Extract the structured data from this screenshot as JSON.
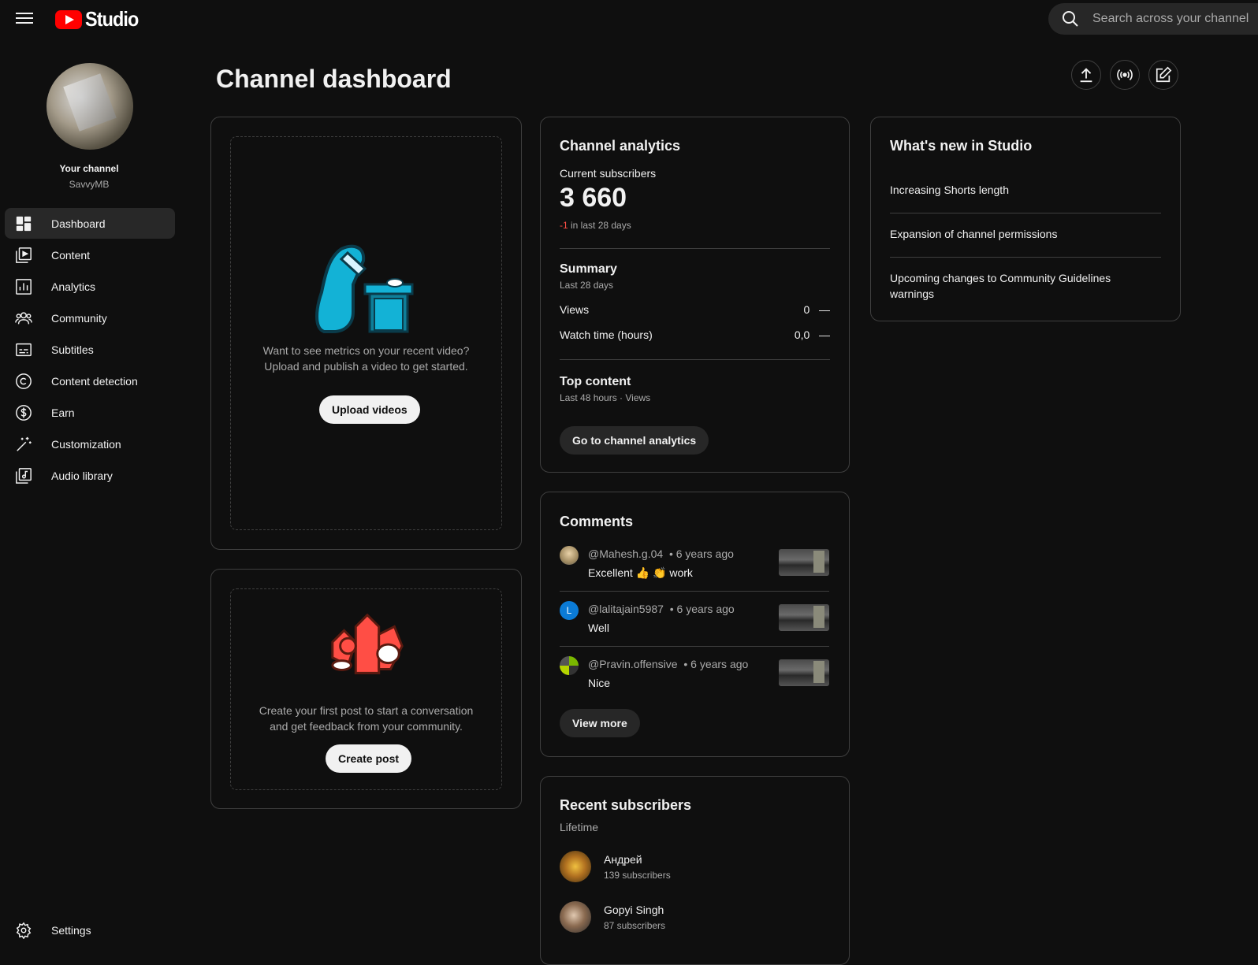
{
  "app": {
    "title": "Studio"
  },
  "search": {
    "placeholder": "Search across your channel"
  },
  "channel": {
    "label": "Your channel",
    "name": "SavvyMB"
  },
  "nav": [
    {
      "label": "Dashboard",
      "icon": "dashboard-icon",
      "active": true
    },
    {
      "label": "Content",
      "icon": "content-icon"
    },
    {
      "label": "Analytics",
      "icon": "analytics-icon"
    },
    {
      "label": "Community",
      "icon": "community-icon"
    },
    {
      "label": "Subtitles",
      "icon": "subtitles-icon"
    },
    {
      "label": "Content detection",
      "icon": "copyright-icon"
    },
    {
      "label": "Earn",
      "icon": "dollar-icon"
    },
    {
      "label": "Customization",
      "icon": "magic-wand-icon"
    },
    {
      "label": "Audio library",
      "icon": "audio-library-icon"
    }
  ],
  "settings": {
    "label": "Settings"
  },
  "page": {
    "title": "Channel dashboard"
  },
  "header_actions": [
    "upload-icon",
    "live-icon",
    "create-post-icon"
  ],
  "video_card": {
    "line1": "Want to see metrics on your recent video?",
    "line2": "Upload and publish a video to get started.",
    "button": "Upload videos"
  },
  "post_card": {
    "line1": "Create your first post to start a conversation",
    "line2": "and get feedback from your community.",
    "button": "Create post"
  },
  "analytics": {
    "title": "Channel analytics",
    "subs_label": "Current subscribers",
    "subs_value": "3 660",
    "subs_change": "-1",
    "subs_change_suffix": " in last 28 days",
    "summary_title": "Summary",
    "summary_period": "Last 28 days",
    "rows": [
      {
        "label": "Views",
        "value": "0",
        "trend": "—"
      },
      {
        "label": "Watch time (hours)",
        "value": "0,0",
        "trend": "—"
      }
    ],
    "top_title": "Top content",
    "top_period": "Last 48 hours · Views",
    "button": "Go to channel analytics"
  },
  "comments": {
    "title": "Comments",
    "items": [
      {
        "author": "@Mahesh.g.04",
        "time": "• 6 years ago",
        "text": "Excellent 👍 👏 work"
      },
      {
        "author": "@lalitajain5987",
        "time": "• 6 years ago",
        "text": "Well",
        "initial": "L"
      },
      {
        "author": "@Pravin.offensive",
        "time": "• 6 years ago",
        "text": "Nice"
      }
    ],
    "button": "View more"
  },
  "subscribers": {
    "title": "Recent subscribers",
    "period": "Lifetime",
    "items": [
      {
        "name": "Андрей",
        "count": "139 subscribers"
      },
      {
        "name": "Gopyi Singh",
        "count": "87 subscribers"
      }
    ]
  },
  "whats_new": {
    "title": "What's new in Studio",
    "items": [
      "Increasing Shorts length",
      "Expansion of channel permissions",
      "Upcoming changes to Community Guidelines warnings"
    ]
  },
  "colors": {
    "brand_red": "#ff0000",
    "negative": "#ff4e45",
    "bg": "#0f0f0f",
    "border": "#3f3f3f"
  }
}
